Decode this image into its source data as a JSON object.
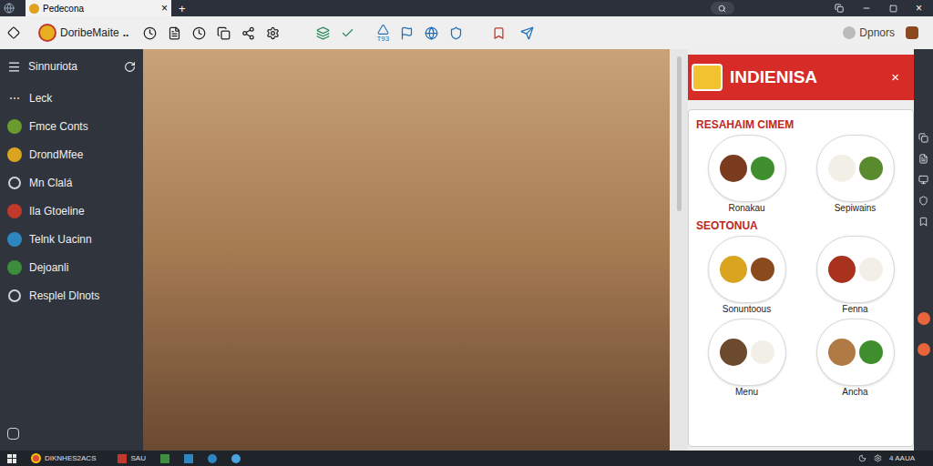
{
  "window": {
    "tab_title": "Pedecona",
    "close": "×",
    "new_tab": "+"
  },
  "toolbar": {
    "app_name": "DoribeMaite",
    "more": "..",
    "icon_label": "T93",
    "profile": "Dpnors"
  },
  "sidebar": {
    "title": "Sinnuriota",
    "items": [
      {
        "label": "Leck",
        "kind": "glyph",
        "icon": "⋯"
      },
      {
        "label": "Fmce Conts",
        "kind": "badge",
        "color": "#6b9a2e"
      },
      {
        "label": "DrondMfee",
        "kind": "badge",
        "color": "#d9a520"
      },
      {
        "label": "Mn Clalá",
        "kind": "outline",
        "color": "#cfd4da"
      },
      {
        "label": "Ila Gtoeline",
        "kind": "badge",
        "color": "#c0392b"
      },
      {
        "label": "Telnk Uacinn",
        "kind": "badge",
        "color": "#2e86c1"
      },
      {
        "label": "Dejoanli",
        "kind": "badge",
        "color": "#3c8d3c"
      },
      {
        "label": "Resplel Dlnots",
        "kind": "outline",
        "color": "#cfd4da"
      }
    ]
  },
  "menu_panel": {
    "title": "INDIENISA",
    "close": "×",
    "sections": [
      {
        "heading": "RESAHAIM CIMEM",
        "dishes": [
          "Ronakau",
          "Sepiwains"
        ]
      },
      {
        "heading": "SEOTONUA",
        "dishes": [
          "Sonuntoous",
          "Fenna",
          "Menu",
          "Ancha"
        ]
      }
    ]
  },
  "taskbar": {
    "items": [
      "DIKNHES2ACS",
      "SAU"
    ],
    "clock": "4 AAUA"
  }
}
